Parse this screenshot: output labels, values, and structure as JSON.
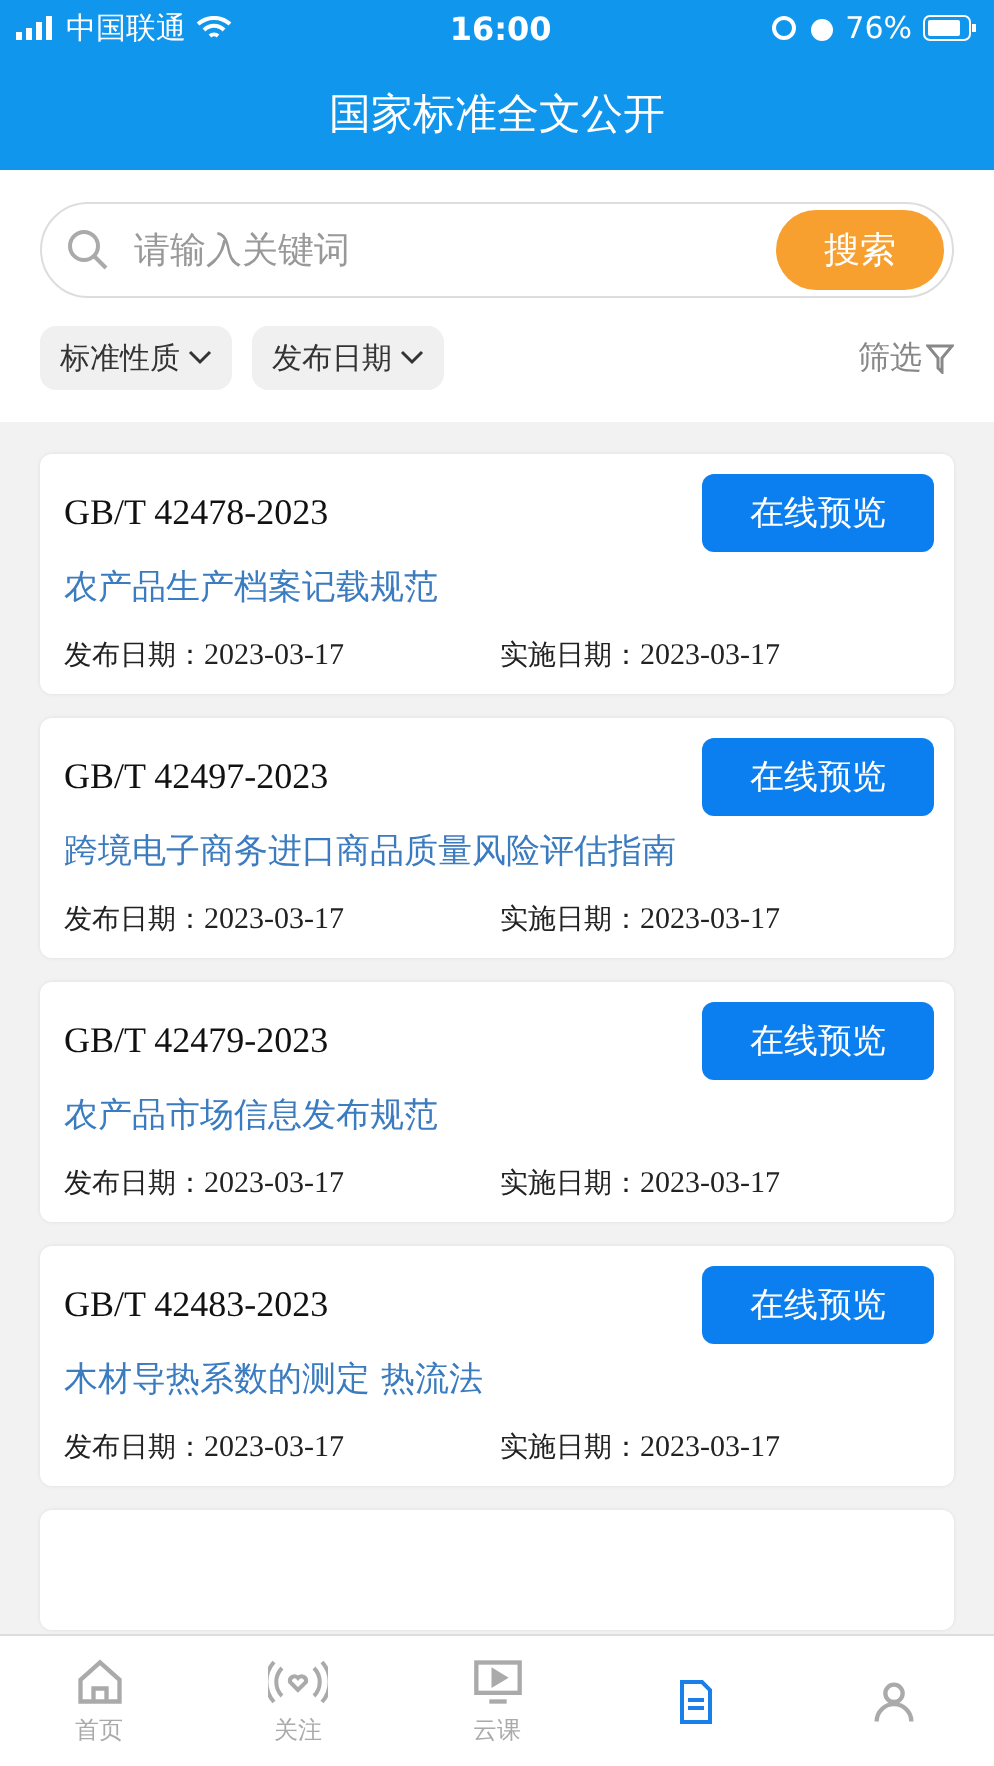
{
  "status_bar": {
    "carrier": "中国联通",
    "time": "16:00",
    "battery": "76%"
  },
  "header": {
    "title": "国家标准全文公开"
  },
  "search": {
    "placeholder": "请输入关键词",
    "button": "搜索"
  },
  "filters": [
    {
      "label": "标准性质"
    },
    {
      "label": "发布日期"
    }
  ],
  "filter_button": "筛选",
  "standards": [
    {
      "code": "GB/T 42478-2023",
      "title": "农产品生产档案记载规范",
      "publish_label": "发布日期：",
      "publish_date": "2023-03-17",
      "effective_label": "实施日期：",
      "effective_date": "2023-03-17",
      "button": "在线预览"
    },
    {
      "code": "GB/T 42497-2023",
      "title": "跨境电子商务进口商品质量风险评估指南",
      "publish_label": "发布日期：",
      "publish_date": "2023-03-17",
      "effective_label": "实施日期：",
      "effective_date": "2023-03-17",
      "button": "在线预览"
    },
    {
      "code": "GB/T 42479-2023",
      "title": "农产品市场信息发布规范",
      "publish_label": "发布日期：",
      "publish_date": "2023-03-17",
      "effective_label": "实施日期：",
      "effective_date": "2023-03-17",
      "button": "在线预览"
    },
    {
      "code": "GB/T 42483-2023",
      "title": "木材导热系数的测定 热流法",
      "publish_label": "发布日期：",
      "publish_date": "2023-03-17",
      "effective_label": "实施日期：",
      "effective_date": "2023-03-17",
      "button": "在线预览"
    }
  ],
  "tab_bar": [
    {
      "kind": "home",
      "label": "首页",
      "selected": false
    },
    {
      "kind": "follow",
      "label": "关注",
      "selected": false
    },
    {
      "kind": "course",
      "label": "云课",
      "selected": false
    },
    {
      "kind": "doc",
      "selected": true
    },
    {
      "kind": "profile",
      "selected": false
    }
  ]
}
